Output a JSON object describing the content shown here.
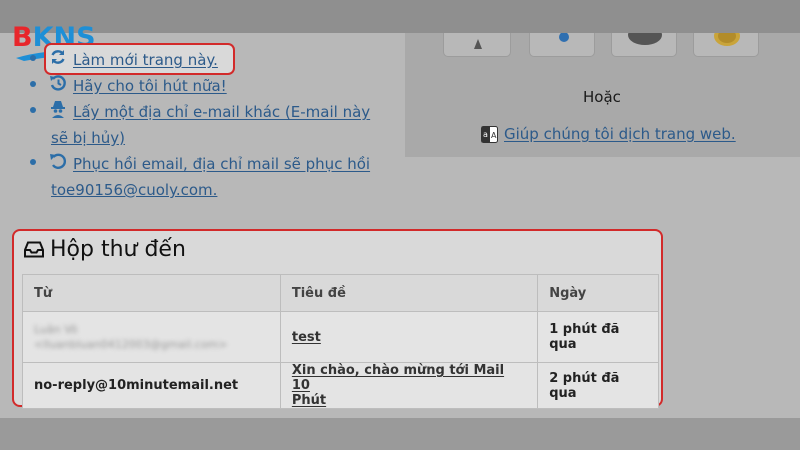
{
  "logo": {
    "b": "B",
    "rest": "KNS"
  },
  "actions": [
    {
      "label": "Làm mới trang này.",
      "icon": "refresh-icon"
    },
    {
      "label": "Hãy cho tôi hút nữa!",
      "icon": "history-icon"
    },
    {
      "label_line1": "Lấy một địa chỉ e-mail khác (E-mail này",
      "label_line2": "sẽ bị hủy)",
      "icon": "spy-icon"
    },
    {
      "label_line1": "Phục hồi email, địa chỉ mail sẽ phục hồi",
      "label_line2": "toe90156@cuoly.com.",
      "icon": "undo-icon"
    }
  ],
  "translate": {
    "or_text": "Hoặc",
    "link_text": "Giúp chúng tôi dịch trang web.",
    "icon": "translate-icon"
  },
  "inbox": {
    "title": "Hộp thư đến",
    "icon": "inbox-icon",
    "columns": {
      "from": "Từ",
      "subject": "Tiêu đề",
      "date": "Ngày"
    },
    "rows": [
      {
        "from_line1": "Luân Võ",
        "from_line2": "<lluanbluan0412003@gmail.com>",
        "subject": "test",
        "date": "1 phút đã qua"
      },
      {
        "from": "no-reply@10minutemail.net",
        "subject_line1": "Xin chào, chào mừng tới Mail 10",
        "subject_line2": "Phút",
        "date": "2 phút đã qua"
      }
    ]
  },
  "colors": {
    "highlight": "#d22a2a",
    "link": "#2c5a8a",
    "logo_red": "#e8262b",
    "logo_blue": "#1e8fd6"
  }
}
